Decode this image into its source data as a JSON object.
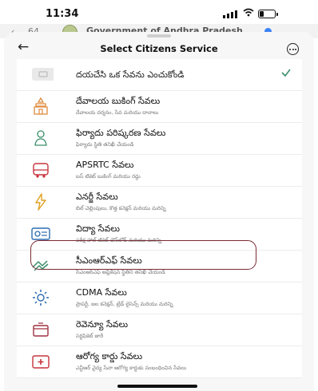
{
  "status_bar": {
    "time": "11:34"
  },
  "background_app": {
    "back_count": "64",
    "title": "Government of Andhra Pradesh"
  },
  "sheet": {
    "title": "Select Citizens Service",
    "placeholder": "దయచేసి ఒక సేవను ఎంచుకోండి",
    "items": [
      {
        "title": "దేవాలయ బుకింగ్ సేవలు",
        "subtitle": "దేవాలయ దర్శనం, సేవ మరియు దానాలు",
        "icon": "temple-icon"
      },
      {
        "title": "ఫిర్యాదు పరిష్కరణ సేవలు",
        "subtitle": "ఫిర్యాదు స్థితి తనిఖీ చేయండి",
        "icon": "grievance-icon"
      },
      {
        "title": "APSRTC సేవలు",
        "subtitle": "బస్ టికెట్ బుకింగ్ మరియు రద్దు",
        "icon": "bus-icon"
      },
      {
        "title": "ఎనర్జీ సేవలు",
        "subtitle": "బిల్ చెల్లింపులు, కొత్త కనెక్షన్ మరియు మరిన్ని",
        "icon": "energy-icon"
      },
      {
        "title": "విద్యా సేవలు",
        "subtitle": "పరీక్ష హాల్ టికెట్ డౌన్‌లోడ్ మరియు మరిన్ని",
        "icon": "education-icon"
      },
      {
        "title": "సీఎంఆర్ఎఫ్ సేవలు",
        "subtitle": "సీఎంఆర్ఎఫ్ అప్లికేషన్ స్థితిని తనిఖీ చేయండి",
        "icon": "cmrf-icon"
      },
      {
        "title": "CDMA సేవలు",
        "subtitle": "ప్రాపర్టీ, జల కనెక్షన్, ట్రేడ్ లైసెన్స్ మరియు మరిన్ని",
        "icon": "cdma-icon"
      },
      {
        "title": "రెవెన్యూ సేవలు",
        "subtitle": "సర్టిఫికెట్ జారీ",
        "icon": "revenue-icon"
      },
      {
        "title": "ఆరోగ్య కార్డు సేవలు",
        "subtitle": "ఎన్టీఆర్ వైద్య సేవా ఆరోగ్య కార్డుకు సంబంధించిన సేవలు",
        "icon": "health-card-icon"
      }
    ]
  },
  "colors": {
    "accent": "#7a2a35",
    "icon": "#e08a3c",
    "check": "#3a8f6b"
  }
}
